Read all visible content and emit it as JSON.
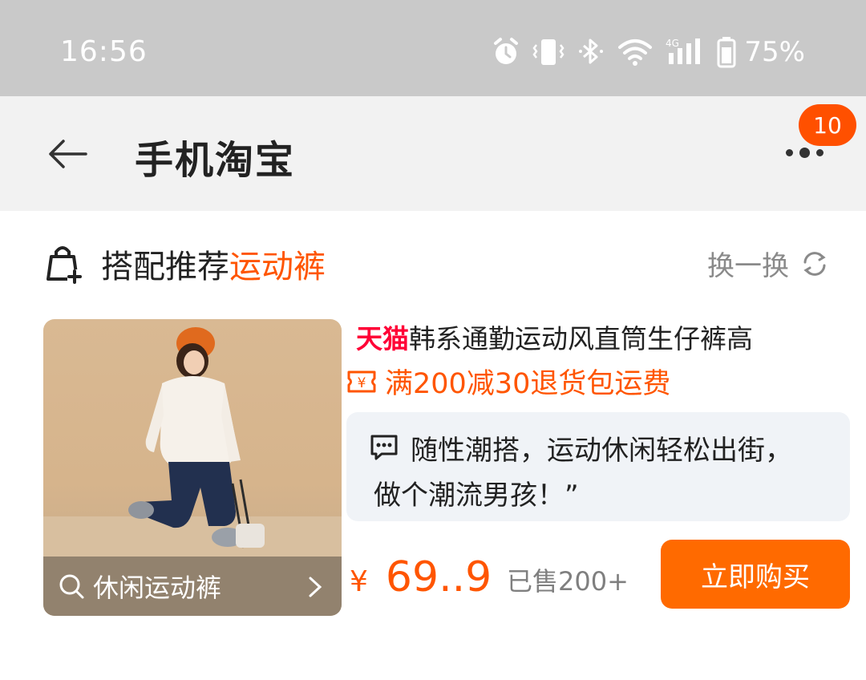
{
  "status_bar": {
    "time": "16:56",
    "battery_percent": "75%",
    "network_label": "4G",
    "icons": [
      "alarm-icon",
      "vibrate-icon",
      "bluetooth-icon",
      "wifi-icon",
      "signal-icon",
      "battery-icon"
    ]
  },
  "header": {
    "title": "手机淘宝",
    "notification_count": "10",
    "back_icon": "back-arrow-icon",
    "more_icon": "more-dots-icon"
  },
  "section": {
    "title_prefix": "搭配推荐",
    "title_accent": "运动裤",
    "refresh_label": "换一换",
    "icon": "shopping-bag-plus-icon"
  },
  "product": {
    "image_search_label": "休闲运动裤",
    "store_tag": "天猫",
    "title": "韩系通勤运动风直筒生仔裤高",
    "promo": "满200减30退货包运费",
    "comment_line1": "随性潮搭，运动休闲轻松出街，",
    "comment_line2": "做个潮流男孩！”",
    "currency": "¥",
    "price": "69..9",
    "sold": "已售200+",
    "buy_label": "立即购买"
  },
  "colors": {
    "accent": "#ff5500",
    "tmall_red": "#ff0036",
    "buy_button": "#ff6a00",
    "status_bar_bg": "#c9c9c9",
    "header_bg": "#f2f2f2"
  }
}
